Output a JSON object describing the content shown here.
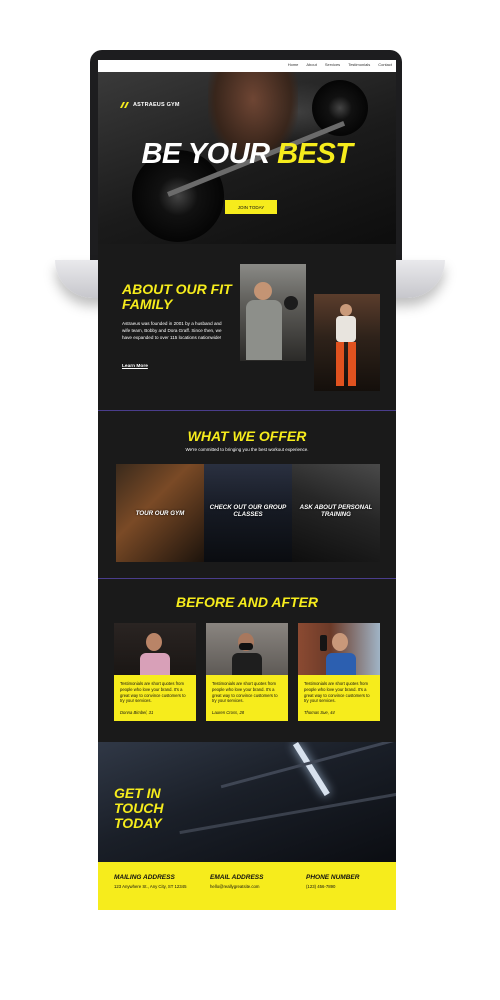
{
  "nav": {
    "links": [
      "Home",
      "About",
      "Services",
      "Testimonials",
      "Contact"
    ]
  },
  "hero": {
    "brand": "ASTRAEUS GYM",
    "title_white": "BE YOUR",
    "title_yellow": "BEST",
    "cta": "JOIN TODAY"
  },
  "about": {
    "title": "ABOUT OUR FIT FAMILY",
    "text": "Astraeus was founded in 2001 by a husband and wife team, Bobby and Dora Graff. Since then, we have expanded to over 115 locations nationwide!",
    "link": "Learn More"
  },
  "offer": {
    "title": "WHAT WE OFFER",
    "subtitle": "We're committed to bringing you the best workout experience.",
    "cards": [
      "TOUR OUR GYM",
      "CHECK OUT OUR GROUP CLASSES",
      "ASK ABOUT PERSONAL TRAINING"
    ]
  },
  "before_after": {
    "title": "BEFORE AND AFTER",
    "cards": [
      {
        "quote": "Testimonials are short quotes from people who love your brand. It's a great way to convince customers to try your services.",
        "name": "Donna Bimbel, 31"
      },
      {
        "quote": "Testimonials are short quotes from people who love your brand. It's a great way to convince customers to try your services.",
        "name": "Lauren Cross, 28"
      },
      {
        "quote": "Testimonials are short quotes from people who love your brand. It's a great way to convince customers to try your services.",
        "name": "Thomas Sue, 44"
      }
    ]
  },
  "contact": {
    "title": "GET IN TOUCH TODAY",
    "mailing_label": "MAILING ADDRESS",
    "mailing_value": "123 Anywhere St., Any City, ST 12345",
    "email_label": "EMAIL ADDRESS",
    "email_value": "hello@reallygreatsite.com",
    "phone_label": "PHONE NUMBER",
    "phone_value": "(123) 456-7890"
  },
  "colors": {
    "accent": "#f6ec1c",
    "background": "#1a1a1a",
    "divider": "#4a3d8c"
  }
}
